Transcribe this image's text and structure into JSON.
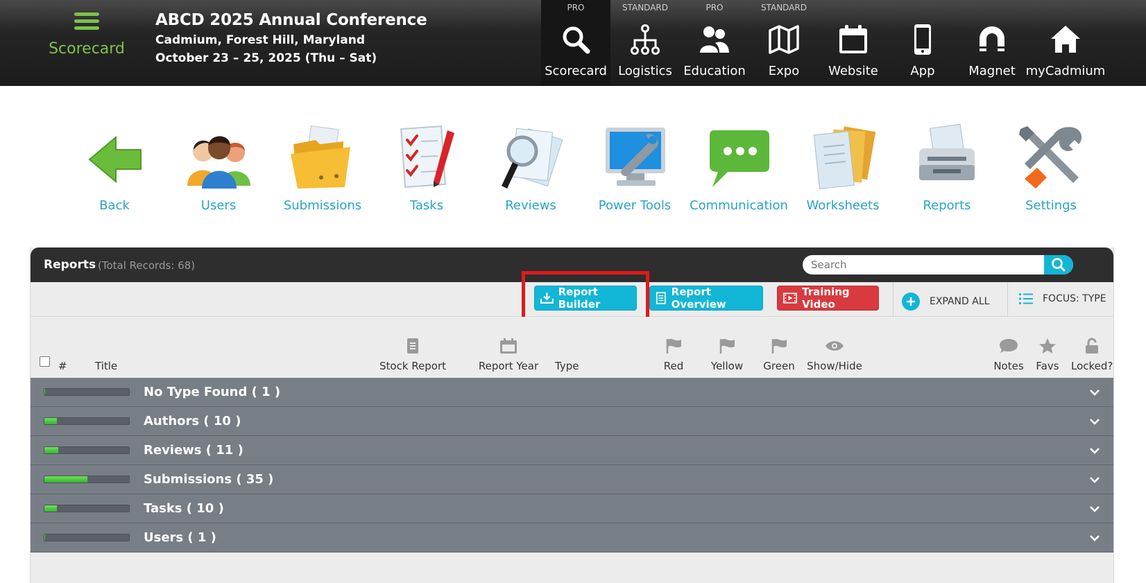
{
  "brand": {
    "label": "Scorecard"
  },
  "conference": {
    "title": "ABCD 2025 Annual Conference",
    "location": "Cadmium, Forest Hill, Maryland",
    "dates": "October 23 – 25, 2025 (Thu – Sat)"
  },
  "topnav": [
    {
      "tier": "PRO",
      "label": "Scorecard",
      "icon": "search-icon",
      "active": true
    },
    {
      "tier": "STANDARD",
      "label": "Logistics",
      "icon": "hierarchy-icon"
    },
    {
      "tier": "PRO",
      "label": "Education",
      "icon": "people-icon"
    },
    {
      "tier": "STANDARD",
      "label": "Expo",
      "icon": "map-icon"
    },
    {
      "tier": "",
      "label": "Website",
      "icon": "calendar-icon"
    },
    {
      "tier": "",
      "label": "App",
      "icon": "phone-icon"
    },
    {
      "tier": "",
      "label": "Magnet",
      "icon": "magnet-icon"
    },
    {
      "tier": "",
      "label": "myCadmium",
      "icon": "home-icon"
    }
  ],
  "tools": [
    {
      "label": "Back",
      "icon": "back-arrow-icon"
    },
    {
      "label": "Users",
      "icon": "users-icon"
    },
    {
      "label": "Submissions",
      "icon": "folder-icon"
    },
    {
      "label": "Tasks",
      "icon": "checklist-icon"
    },
    {
      "label": "Reviews",
      "icon": "magnifier-icon"
    },
    {
      "label": "Power Tools",
      "icon": "monitor-wrench-icon"
    },
    {
      "label": "Communication",
      "icon": "chat-bubble-icon"
    },
    {
      "label": "Worksheets",
      "icon": "documents-icon"
    },
    {
      "label": "Reports",
      "icon": "printer-icon"
    },
    {
      "label": "Settings",
      "icon": "tools-icon"
    }
  ],
  "panel": {
    "title": "Reports",
    "count": "(Total Records: 68)",
    "search_placeholder": "Search"
  },
  "toolbar": {
    "report_builder": "Report Builder",
    "report_overview": "Report Overview",
    "training_video": "Training Video",
    "expand_all": "EXPAND ALL",
    "focus": "FOCUS: TYPE"
  },
  "columns": {
    "num": "#",
    "title": "Title",
    "stock_report": "Stock Report",
    "report_year": "Report Year",
    "type": "Type",
    "red": "Red",
    "yellow": "Yellow",
    "green": "Green",
    "show_hide": "Show/Hide",
    "notes": "Notes",
    "favs": "Favs",
    "locked": "Locked?"
  },
  "groups": [
    {
      "label": "No Type Found   ( 1 )",
      "progress": 0.01
    },
    {
      "label": "Authors   ( 10 )",
      "progress": 0.15
    },
    {
      "label": "Reviews   ( 11 )",
      "progress": 0.16
    },
    {
      "label": "Submissions   ( 35 )",
      "progress": 0.51
    },
    {
      "label": "Tasks   ( 10 )",
      "progress": 0.15
    },
    {
      "label": "Users   ( 1 )",
      "progress": 0.01
    }
  ],
  "colors": {
    "accent": "#12b6d6",
    "brand_green": "#7cc34b",
    "danger": "#d83a3f",
    "link": "#2aa4c5"
  }
}
